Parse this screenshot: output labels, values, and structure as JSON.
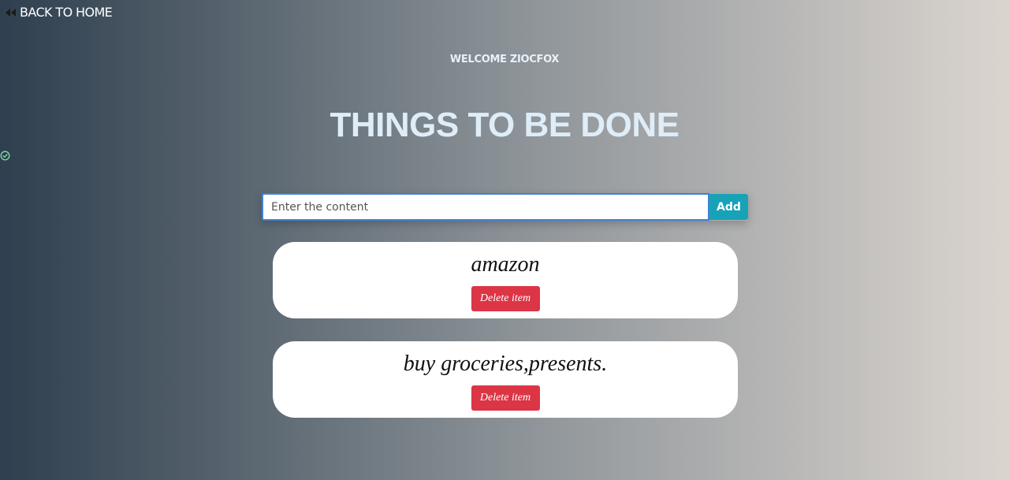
{
  "nav": {
    "back_label": "BACK TO HOME",
    "back_icon": "double-chevron-left-icon"
  },
  "header": {
    "welcome": "WELCOME ZIOCFOX",
    "title": "THINGS TO BE DONE"
  },
  "status": {
    "icon": "check-circle-icon",
    "color": "#7fe0a0"
  },
  "form": {
    "input_value": "",
    "input_placeholder": "Enter the content",
    "add_label": "Add",
    "add_color": "#17a2b8"
  },
  "todos": [
    {
      "text": "amazon",
      "delete_label": "Delete item"
    },
    {
      "text": "buy groceries,presents.",
      "delete_label": "Delete item"
    }
  ],
  "colors": {
    "delete": "#dc3545",
    "title": "#deedf8",
    "card": "#ffffff"
  }
}
